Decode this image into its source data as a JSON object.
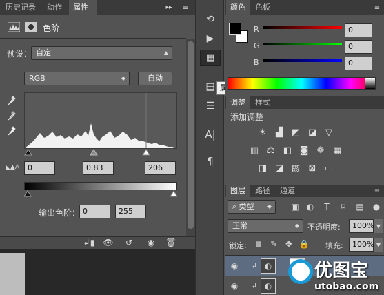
{
  "left_panel": {
    "tabs": [
      "历史记录",
      "动作",
      "属性"
    ],
    "menu_icon": "double-chevron-menu-icon",
    "title": "色阶",
    "preset_label": "预设：",
    "preset_value": "自定",
    "channel_value": "RGB",
    "auto_button": "自动",
    "input_black": "0",
    "input_gray": "0.83",
    "input_white": "206",
    "output_label": "输出色阶：",
    "output_black": "0",
    "output_white": "255"
  },
  "toolbar_tooltip": "属性",
  "right_panel": {
    "color_tabs": [
      "颜色",
      "色板"
    ],
    "channels": [
      {
        "label": "R",
        "value": "0",
        "color": "#e02020"
      },
      {
        "label": "G",
        "value": "0",
        "color": "#20c020"
      },
      {
        "label": "B",
        "value": "0",
        "color": "#2040e0"
      }
    ],
    "adjust_tabs": [
      "调整",
      "样式"
    ],
    "adjust_title": "添加调整",
    "layers_tabs": [
      "图层",
      "路径",
      "通道"
    ],
    "filter_label": "类型",
    "blend_mode": "正常",
    "opacity_label": "不透明度:",
    "opacity_value": "100%",
    "lock_label": "锁定:",
    "fill_label": "填充:",
    "fill_value": "100%"
  },
  "watermark": {
    "line1": "优图宝",
    "line2": "utobao.com"
  }
}
